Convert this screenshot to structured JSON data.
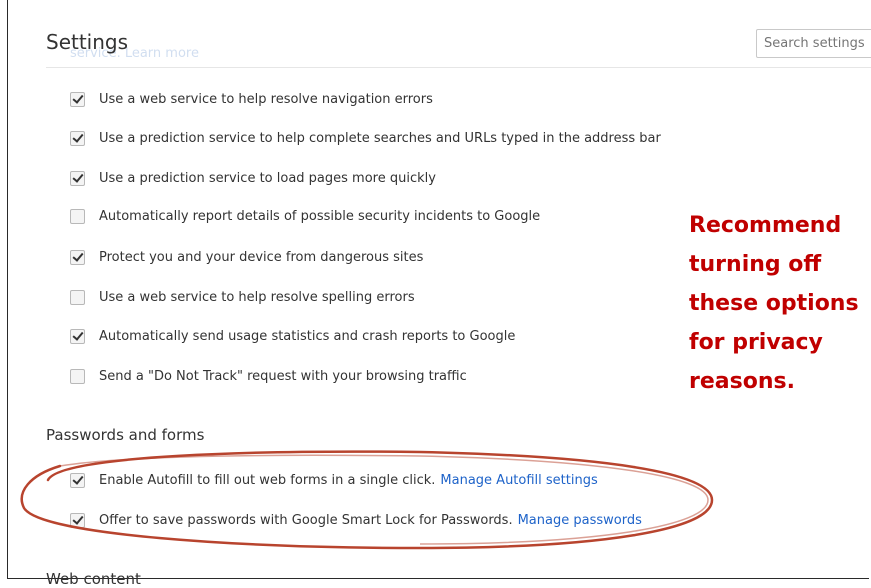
{
  "header": {
    "title": "Settings",
    "ghost_text": "service. Learn more",
    "search_placeholder": "Search settings"
  },
  "privacy_options": [
    {
      "label": "Use a web service to help resolve navigation errors",
      "checked": true
    },
    {
      "label": "Use a prediction service to help complete searches and URLs typed in the address bar",
      "checked": true
    },
    {
      "label": "Use a prediction service to load pages more quickly",
      "checked": true
    },
    {
      "label": "Automatically report details of possible security incidents to Google",
      "checked": false
    },
    {
      "label": "Protect you and your device from dangerous sites",
      "checked": true
    },
    {
      "label": "Use a web service to help resolve spelling errors",
      "checked": false
    },
    {
      "label": "Automatically send usage statistics and crash reports to Google",
      "checked": true
    },
    {
      "label": "Send a \"Do Not Track\" request with your browsing traffic",
      "checked": false
    }
  ],
  "passwords_section": {
    "heading": "Passwords and forms",
    "options": [
      {
        "label": "Enable Autofill to fill out web forms in a single click.",
        "link": "Manage Autofill settings",
        "checked": true
      },
      {
        "label": "Offer to save passwords with Google Smart Lock for Passwords.",
        "link": "Manage passwords",
        "checked": true
      }
    ]
  },
  "next_section": {
    "heading": "Web content"
  },
  "annotation": {
    "lines": [
      "Recommend",
      "turning off",
      "these options",
      "for privacy",
      "reasons."
    ],
    "color": "#c00000",
    "oval_color": "#b8442e"
  }
}
